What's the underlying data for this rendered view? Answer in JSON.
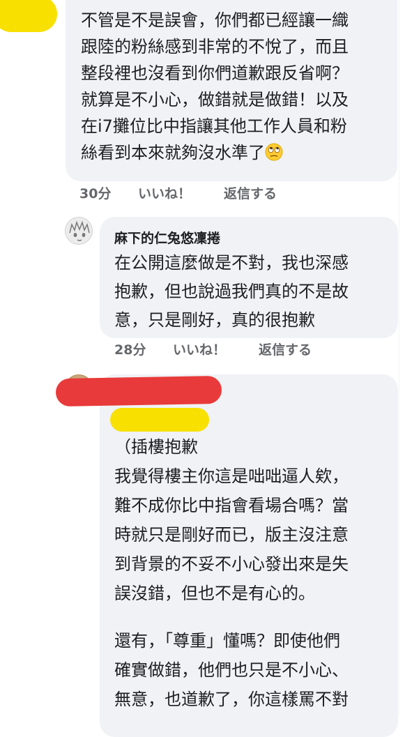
{
  "comments": [
    {
      "author": "",
      "lines": [
        "不管是不是誤會，你們都已經讓一織",
        "跟陸的粉絲感到非常的不悅了，而且",
        "整段裡也沒看到你們道歉跟反省啊？",
        "就算是不小心，做錯就是做錯！以及",
        "在i7攤位比中指讓其他工作人員和粉",
        "絲看到本來就夠沒水準了"
      ],
      "trailing_emoji": "eye-roll-emoji",
      "time": "30分",
      "like_label": "いいね！",
      "reply_label": "返信する"
    },
    {
      "author": "麻下的仁兔悠凜捲",
      "lines": [
        "在公開這麼做是不對，我也深感",
        "抱歉，但也說過我們真的不是故",
        "意，只是剛好，真的很抱歉"
      ],
      "time": "28分",
      "like_label": "いいね！",
      "reply_label": "返信する"
    },
    {
      "author": "",
      "lines": [
        "（插樓抱歉",
        "我覺得樓主你這是咄咄逼人欸，",
        "難不成你比中指會看場合嗎？當",
        "時就只是剛好而已，版主沒注意",
        "到背景的不妥不小心發出來是失",
        "誤沒錯，但也不是有心的。",
        "",
        "還有，「尊重」懂嗎？即使他們",
        "確實做錯，他們也只是不小心、",
        "無意，也道歉了，你這樣罵不對"
      ]
    }
  ],
  "redaction_colors": {
    "yellow": "#f8e000",
    "red": "#e83a3a"
  }
}
